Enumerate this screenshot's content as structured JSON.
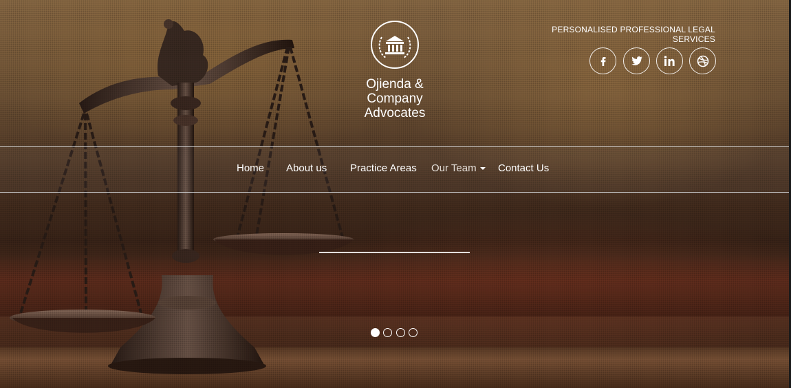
{
  "brand": {
    "logo_line1": "Ojienda &",
    "logo_line2": "Company",
    "logo_line3": "Advocates"
  },
  "header": {
    "tagline": "PERSONALISED PROFESSIONAL LEGAL SERVICES"
  },
  "social": [
    {
      "name": "facebook",
      "glyph": "f"
    },
    {
      "name": "twitter",
      "glyph": "twitter"
    },
    {
      "name": "linkedin",
      "glyph": "in"
    },
    {
      "name": "dribbble",
      "glyph": "dribbble"
    }
  ],
  "nav": {
    "items": [
      {
        "label": "Home"
      },
      {
        "label": "About us"
      },
      {
        "label": "Practice Areas"
      },
      {
        "label": "Our Team",
        "has_dropdown": true
      },
      {
        "label": "Contact Us"
      }
    ]
  },
  "slider": {
    "total_slides": 4,
    "active_index": 0
  },
  "colors": {
    "text": "#ffffff",
    "nav_line": "#e6ebf0"
  }
}
